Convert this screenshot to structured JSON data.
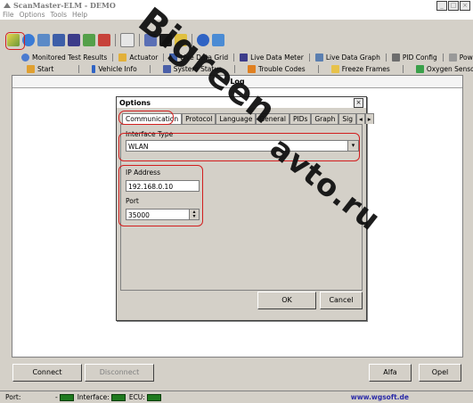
{
  "app": {
    "title": "ScanMaster-ELM - DEMO",
    "window_buttons": [
      "_",
      "□",
      "×"
    ],
    "menu": [
      "File",
      "Options",
      "Tools",
      "Help"
    ]
  },
  "toolbar_icons": [
    "wizard-icon",
    "connect-icon",
    "data-icon",
    "grid-icon",
    "meter-icon",
    "graph-icon",
    "settings-icon",
    "dtc-icon",
    "chat-icon",
    "terminal-icon",
    "battery-icon",
    "info-icon",
    "exit-icon"
  ],
  "tabs_row1": [
    {
      "label": "Monitored Test Results",
      "icon": "test-icon"
    },
    {
      "label": "Actuator",
      "icon": "actuator-icon"
    },
    {
      "label": "Live Data Grid",
      "icon": "grid-icon"
    },
    {
      "label": "Live Data Meter",
      "icon": "meter-icon"
    },
    {
      "label": "Live Data Graph",
      "icon": "graph-icon"
    },
    {
      "label": "PID Config",
      "icon": "pid-icon"
    },
    {
      "label": "Power",
      "icon": "power-icon"
    }
  ],
  "tabs_row2": [
    {
      "label": "Start",
      "icon": "start-icon"
    },
    {
      "label": "Vehicle Info",
      "icon": "info-icon"
    },
    {
      "label": "System Status",
      "icon": "status-icon"
    },
    {
      "label": "Trouble Codes",
      "icon": "warning-icon"
    },
    {
      "label": "Freeze Frames",
      "icon": "freeze-icon"
    },
    {
      "label": "Oxygen Sensors",
      "icon": "sensor-icon"
    }
  ],
  "log": {
    "title": "Log"
  },
  "dialog": {
    "title": "Options",
    "close": "×",
    "tabs": [
      "Communication",
      "Protocol",
      "Language",
      "General",
      "PIDs",
      "Graph",
      "Sig"
    ],
    "interface_type_label": "Interface Type",
    "interface_type_value": "WLAN",
    "ip_label": "IP Address",
    "ip_value": "192.168.0.10",
    "port_label": "Port",
    "port_value": "35000",
    "ok": "OK",
    "cancel": "Cancel"
  },
  "bottom": {
    "connect": "Connect",
    "disconnect": "Disconnect",
    "alfa": "Alfa",
    "opel": "Opel"
  },
  "status": {
    "port_label": "Port:",
    "port_value": "-",
    "interface_label": "Interface:",
    "ecu_label": "ECU:",
    "website": "www.wgsoft.de"
  },
  "watermark": [
    "Bigreen",
    "avto.ru"
  ],
  "colors": {
    "highlight": "#d21e1e",
    "led_green": "#1f7a1f",
    "website": "#2a2aa8"
  }
}
